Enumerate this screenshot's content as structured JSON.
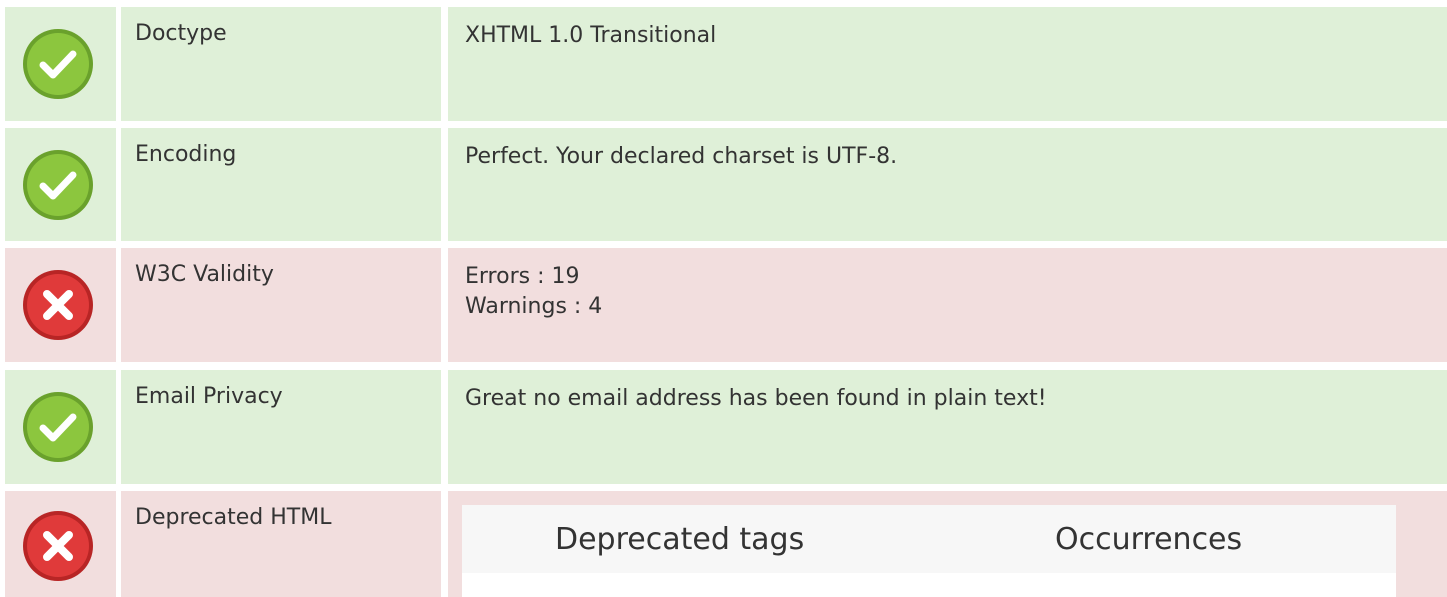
{
  "rows": [
    {
      "status": "ok",
      "status_icon": "check-circle-icon",
      "label": "Doctype",
      "value": [
        "XHTML 1.0 Transitional"
      ]
    },
    {
      "status": "ok",
      "status_icon": "check-circle-icon",
      "label": "Encoding",
      "value": [
        "Perfect. Your declared charset is UTF-8."
      ]
    },
    {
      "status": "error",
      "status_icon": "x-circle-icon",
      "label": "W3C Validity",
      "value": [
        "Errors : 19",
        "Warnings : 4"
      ]
    },
    {
      "status": "ok",
      "status_icon": "check-circle-icon",
      "label": "Email Privacy",
      "value": [
        "Great no email address has been found in plain text!"
      ]
    },
    {
      "status": "error",
      "status_icon": "x-circle-icon",
      "label": "Deprecated HTML",
      "table": {
        "headers": [
          "Deprecated tags",
          "Occurrences"
        ]
      }
    }
  ],
  "colors": {
    "ok_background": "#dff0d8",
    "error_background": "#f2dede",
    "ok_icon": "#8cc63e",
    "error_icon": "#e03a3a"
  }
}
